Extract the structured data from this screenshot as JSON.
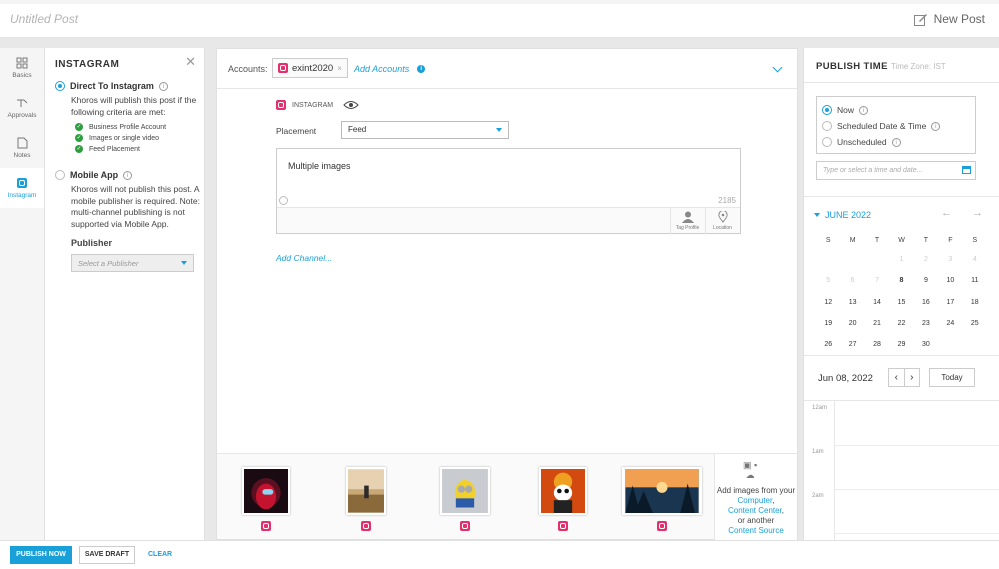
{
  "header": {
    "post_title": "Untitled Post",
    "new_post_label": "New Post"
  },
  "rail": {
    "items": [
      {
        "label": "Basics",
        "icon": "basics-icon"
      },
      {
        "label": "Approvals",
        "icon": "approvals-icon"
      },
      {
        "label": "Notes",
        "icon": "notes-icon"
      },
      {
        "label": "Instagram",
        "icon": "instagram-icon",
        "active": true
      }
    ]
  },
  "instagram_panel": {
    "title": "INSTAGRAM",
    "direct_label": "Direct To Instagram",
    "direct_text": "Khoros will publish this post if the following criteria are met:",
    "criteria": [
      "Business Profile Account",
      "Images or single video",
      "Feed Placement"
    ],
    "mobile_label": "Mobile App",
    "mobile_text": "Khoros will not publish this post. A mobile publisher is required. Note: multi-channel publishing is not supported via Mobile App.",
    "publisher_label": "Publisher",
    "publisher_placeholder": "Select a Publisher"
  },
  "composer": {
    "accounts_label": "Accounts:",
    "account_chip": "exint2020",
    "add_accounts": "Add Accounts",
    "channel_name": "INSTAGRAM",
    "placement_label": "Placement",
    "placement_value": "Feed",
    "body_text": "Multiple images",
    "char_count": "2185",
    "tag_profile": "Tag Profile",
    "location": "Location",
    "add_channel": "Add Channel..."
  },
  "media": {
    "add_images_prefix": "Add images from your",
    "computer": "Computer",
    "content_center": "Content Center",
    "or_another": "or another",
    "content_source": "Content Source"
  },
  "publish_time": {
    "title": "PUBLISH TIME",
    "time_zone": "Time Zone: IST",
    "options": [
      "Now",
      "Scheduled Date & Time",
      "Unscheduled"
    ],
    "date_placeholder": "Type or select a time and date...",
    "month_label": "JUNE 2022",
    "weekdays": [
      "S",
      "M",
      "T",
      "W",
      "T",
      "F",
      "S"
    ],
    "selected_date": "Jun 08, 2022",
    "today_label": "Today",
    "times": [
      "12am",
      "1am",
      "2am"
    ]
  },
  "footer": {
    "publish_now": "PUBLISH NOW",
    "save_draft": "SAVE DRAFT",
    "clear": "CLEAR"
  },
  "colors": {
    "accent": "#1aa0d8",
    "instagram": "#e1306c",
    "success": "#2e9e3e"
  }
}
